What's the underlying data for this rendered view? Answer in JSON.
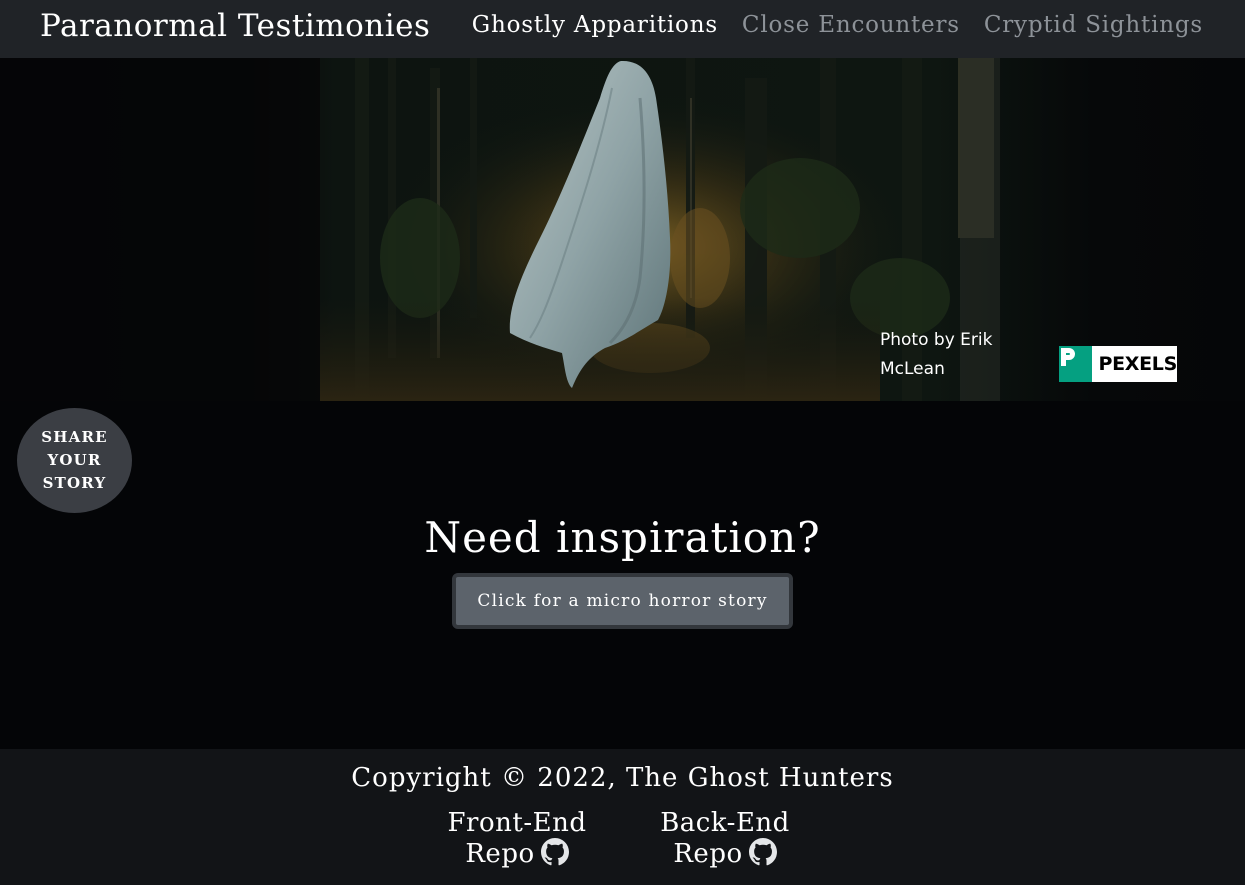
{
  "navbar": {
    "brand": "Paranormal Testimonies",
    "links": [
      {
        "label": "Ghostly Apparitions",
        "active": true
      },
      {
        "label": "Close Encounters",
        "active": false
      },
      {
        "label": "Cryptid Sightings",
        "active": false
      }
    ]
  },
  "hero": {
    "photo_credit_line1": "Photo by Erik",
    "photo_credit_line2": "McLean",
    "pexels_label": "PEXELS",
    "pexels_icon": "pexels-logo-icon"
  },
  "share_button": {
    "line1": "SHARE",
    "line2": "YOUR",
    "line3": "STORY"
  },
  "main": {
    "heading": "Need inspiration?",
    "button_label": "Click for a micro horror story"
  },
  "footer": {
    "copyright": "Copyright © 2022, The Ghost Hunters",
    "front_end_line1": "Front-End",
    "front_end_line2": "Repo",
    "back_end_line1": "Back-End",
    "back_end_line2": "Repo",
    "repo_icon": "github-icon"
  },
  "colors": {
    "navbar_bg": "#202327",
    "page_bg": "#040507",
    "footer_bg": "#121417",
    "button_bg": "#5c636b",
    "share_bg": "#3b3e44",
    "pexels_green": "#05a081",
    "inactive_link": "#8d9298"
  }
}
